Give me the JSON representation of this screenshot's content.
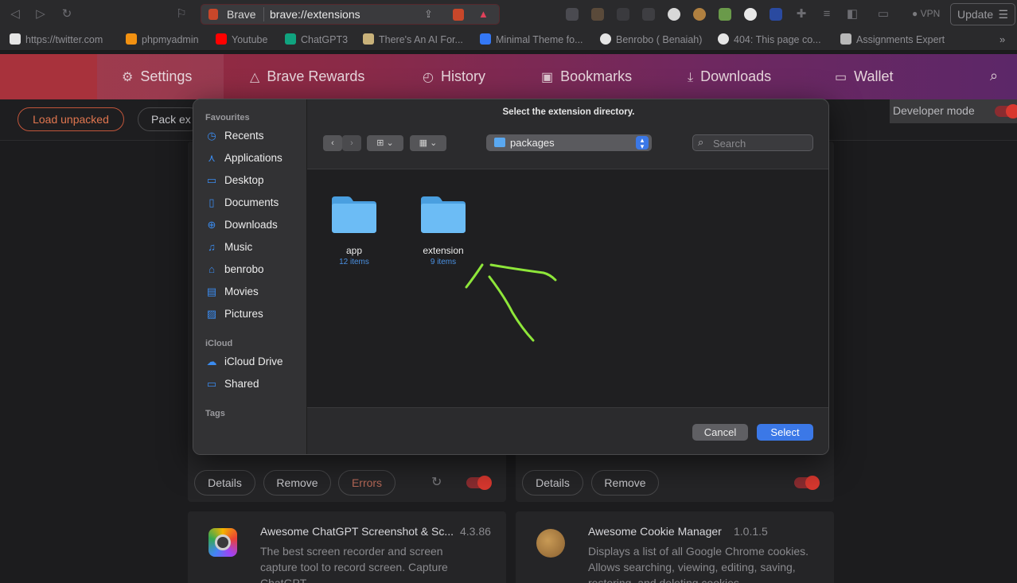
{
  "browser": {
    "site_name": "Brave",
    "url": "brave://extensions",
    "vpn_label": "VPN",
    "update_label": "Update"
  },
  "bookmarks": [
    {
      "label": "https://twitter.com",
      "icon": "x-icon",
      "color": "#e5e5e5"
    },
    {
      "label": "phpmyadmin",
      "icon": "phpmyadmin-icon",
      "color": "#f29111"
    },
    {
      "label": "Youtube",
      "icon": "youtube-icon",
      "color": "#ff0000"
    },
    {
      "label": "ChatGPT3",
      "icon": "chatgpt-icon",
      "color": "#10a37f"
    },
    {
      "label": "There's An AI For...",
      "icon": "ai-icon",
      "color": "#c9b27a"
    },
    {
      "label": "Minimal Theme fo...",
      "icon": "obsidian-icon",
      "color": "#3478f6"
    },
    {
      "label": "Benrobo ( Benaiah)",
      "icon": "github-icon",
      "color": "#e5e5e5"
    },
    {
      "label": "404: This page co...",
      "icon": "vercel-icon",
      "color": "#e5e5e5"
    },
    {
      "label": "Assignments Expert",
      "icon": "pen-icon",
      "color": "#e5e5e5"
    }
  ],
  "settings_tabs": [
    {
      "label": "Settings",
      "icon": "⚙"
    },
    {
      "label": "Brave Rewards",
      "icon": "△"
    },
    {
      "label": "History",
      "icon": "◴"
    },
    {
      "label": "Bookmarks",
      "icon": "▣"
    },
    {
      "label": "Downloads",
      "icon": "⤓"
    },
    {
      "label": "Wallet",
      "icon": "▭"
    }
  ],
  "toolbar": {
    "load_unpacked": "Load unpacked",
    "pack_extension": "Pack ex",
    "developer_mode": "Developer mode"
  },
  "cards": {
    "buttons": {
      "details": "Details",
      "remove": "Remove",
      "errors": "Errors"
    },
    "ext1": {
      "name": "Awesome ChatGPT Screenshot & Sc...",
      "version": "4.3.86",
      "desc": "The best screen recorder and screen capture tool to record screen. Capture ChatGPT"
    },
    "ext2": {
      "name": "Awesome Cookie Manager",
      "version": "1.0.1.5",
      "desc": "Displays a list of all Google Chrome cookies. Allows searching, viewing, editing, saving, restoring, and deleting cookies."
    }
  },
  "dialog": {
    "title": "Select the extension directory.",
    "sidebar": {
      "favourites_label": "Favourites",
      "favourites": [
        {
          "label": "Recents",
          "icon": "clock-icon",
          "glyph": "◷"
        },
        {
          "label": "Applications",
          "icon": "applications-icon",
          "glyph": "⋏"
        },
        {
          "label": "Desktop",
          "icon": "desktop-icon",
          "glyph": "▭"
        },
        {
          "label": "Documents",
          "icon": "document-icon",
          "glyph": "▯"
        },
        {
          "label": "Downloads",
          "icon": "download-icon",
          "glyph": "⊕"
        },
        {
          "label": "Music",
          "icon": "music-icon",
          "glyph": "♫"
        },
        {
          "label": "benrobo",
          "icon": "home-icon",
          "glyph": "⌂"
        },
        {
          "label": "Movies",
          "icon": "movies-icon",
          "glyph": "▤"
        },
        {
          "label": "Pictures",
          "icon": "pictures-icon",
          "glyph": "▨"
        }
      ],
      "icloud_label": "iCloud",
      "icloud": [
        {
          "label": "iCloud Drive",
          "icon": "cloud-icon",
          "glyph": "☁"
        },
        {
          "label": "Shared",
          "icon": "shared-folder-icon",
          "glyph": "▭"
        }
      ],
      "tags_label": "Tags"
    },
    "path": "packages",
    "search_placeholder": "Search",
    "folders": [
      {
        "name": "app",
        "count": "12 items"
      },
      {
        "name": "extension",
        "count": "9 items"
      }
    ],
    "cancel_label": "Cancel",
    "select_label": "Select"
  },
  "annotation_color": "#8ee63a"
}
